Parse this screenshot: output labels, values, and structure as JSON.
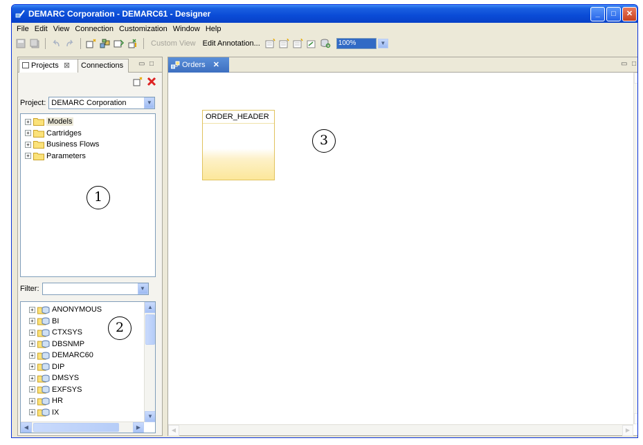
{
  "window": {
    "title": "DEMARC Corporation - DEMARC61 - Designer",
    "controls": {
      "minimize": "_",
      "maximize": "□",
      "close": "✕"
    }
  },
  "menu": [
    "File",
    "Edit",
    "View",
    "Connection",
    "Customization",
    "Window",
    "Help"
  ],
  "toolbar": {
    "custom_view": "Custom View",
    "edit_annotation": "Edit Annotation...",
    "zoom": "100%"
  },
  "left_panel": {
    "tabs": {
      "projects": "Projects",
      "connections": "Connections"
    },
    "project_label": "Project:",
    "project_value": "DEMARC Corporation",
    "tree": [
      "Models",
      "Cartridges",
      "Business Flows",
      "Parameters"
    ],
    "filter_label": "Filter:",
    "filter_value": "",
    "schemas": [
      "ANONYMOUS",
      "BI",
      "CTXSYS",
      "DBSNMP",
      "DEMARC60",
      "DIP",
      "DMSYS",
      "EXFSYS",
      "HR",
      "IX"
    ]
  },
  "editor": {
    "tab_label": "Orders",
    "tab_close": "✕",
    "entity_name": "ORDER_HEADER"
  },
  "callouts": [
    "1",
    "2",
    "3"
  ],
  "colors": {
    "titlebar": "#0a4bd6",
    "selection": "#316ac5",
    "entity_border": "#e0c25c"
  }
}
